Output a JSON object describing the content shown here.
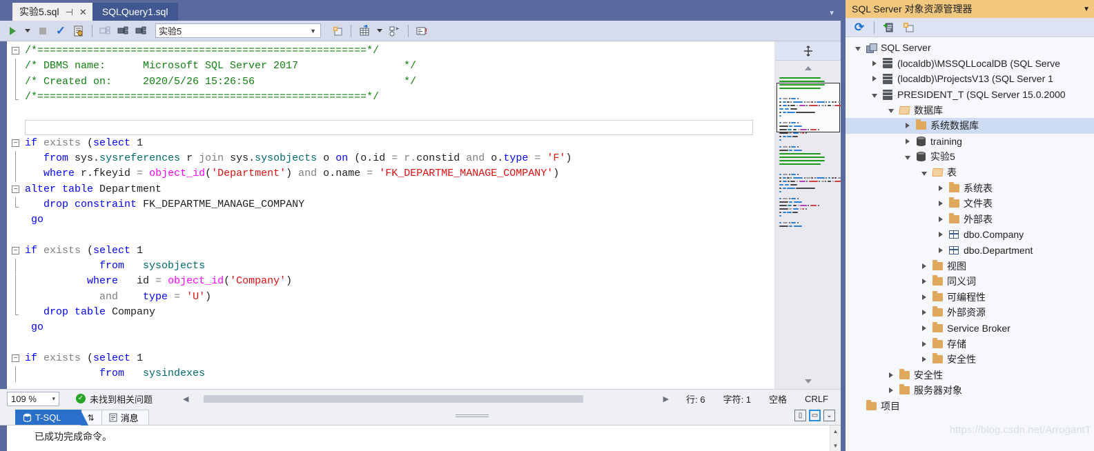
{
  "window": {
    "tab_overflow_icon": "chevron-down-icon"
  },
  "editor_tabs": [
    {
      "label": "实验5.sql",
      "active": true,
      "pin_icon": "pin-icon",
      "close_icon": "close-icon"
    },
    {
      "label": "SQLQuery1.sql",
      "active": false
    }
  ],
  "toolbar": {
    "execute_icon": "play-icon",
    "execute_dropdown_icon": "caret-down-icon",
    "stop_icon": "stop-icon",
    "parse_icon": "check-icon",
    "debug_icon": "debug-script-icon",
    "disconnect_icon": "disconnect-icon",
    "connect_icon": "connect-icon",
    "change_connection_icon": "change-connection-icon",
    "database_combo_value": "实验5",
    "database_combo_caret": "caret-down-icon",
    "new_query_icon": "new-query-icon",
    "include_actual_plan_icon": "grid-plan-icon",
    "include_plan_caret": "caret-down-icon",
    "estimated_plan_icon": "estimated-plan-icon",
    "results_to_text_icon": "results-to-text-icon"
  },
  "code": {
    "lines": [
      {
        "fold": "minus",
        "guide": "none",
        "tokens": [
          {
            "t": "/*=====================================================*/",
            "c": "cm"
          }
        ]
      },
      {
        "guide": "bar",
        "tokens": [
          {
            "t": "/* DBMS name:      Microsoft SQL Server 2017                 */",
            "c": "cm"
          }
        ]
      },
      {
        "guide": "bar",
        "tokens": [
          {
            "t": "/* Created on:     2020/5/26 15:26:56                        */",
            "c": "cm"
          }
        ]
      },
      {
        "guide": "end",
        "tokens": [
          {
            "t": "/*=====================================================*/",
            "c": "cm"
          }
        ]
      },
      {
        "guide": "none",
        "tokens": []
      },
      {
        "guide": "none",
        "tokens": [],
        "cursor_box": true
      },
      {
        "fold": "minus",
        "tokens": [
          {
            "t": "if ",
            "c": "kw"
          },
          {
            "t": "exists ",
            "c": "gr"
          },
          {
            "t": "(",
            "c": "pl"
          },
          {
            "t": "select ",
            "c": "kw"
          },
          {
            "t": "1",
            "c": "pl"
          }
        ]
      },
      {
        "guide": "bar",
        "tokens": [
          {
            "t": "   ",
            "c": "pl"
          },
          {
            "t": "from ",
            "c": "kw"
          },
          {
            "t": "sys",
            "c": "pl"
          },
          {
            "t": ".",
            "c": "pl"
          },
          {
            "t": "sysreferences ",
            "c": "tealish"
          },
          {
            "t": "r ",
            "c": "pl"
          },
          {
            "t": "join ",
            "c": "gr"
          },
          {
            "t": "sys",
            "c": "pl"
          },
          {
            "t": ".",
            "c": "pl"
          },
          {
            "t": "sysobjects ",
            "c": "tealish"
          },
          {
            "t": "o ",
            "c": "pl"
          },
          {
            "t": "on ",
            "c": "kw"
          },
          {
            "t": "(o.",
            "c": "pl"
          },
          {
            "t": "id ",
            "c": "pl"
          },
          {
            "t": "= r.",
            "c": "gr"
          },
          {
            "t": "constid ",
            "c": "pl"
          },
          {
            "t": "and ",
            "c": "gr"
          },
          {
            "t": "o.",
            "c": "pl"
          },
          {
            "t": "type ",
            "c": "kw"
          },
          {
            "t": "= ",
            "c": "gr"
          },
          {
            "t": "'F'",
            "c": "str"
          },
          {
            "t": ")",
            "c": "pl"
          }
        ]
      },
      {
        "guide": "bar",
        "tokens": [
          {
            "t": "   ",
            "c": "pl"
          },
          {
            "t": "where ",
            "c": "kw"
          },
          {
            "t": "r.",
            "c": "pl"
          },
          {
            "t": "fkeyid ",
            "c": "pl"
          },
          {
            "t": "= ",
            "c": "gr"
          },
          {
            "t": "object_id",
            "c": "fn"
          },
          {
            "t": "(",
            "c": "pl"
          },
          {
            "t": "'Department'",
            "c": "str"
          },
          {
            "t": ") ",
            "c": "pl"
          },
          {
            "t": "and ",
            "c": "gr"
          },
          {
            "t": "o.",
            "c": "pl"
          },
          {
            "t": "name ",
            "c": "pl"
          },
          {
            "t": "= ",
            "c": "gr"
          },
          {
            "t": "'FK_DEPARTME_MANAGE_COMPANY'",
            "c": "str"
          },
          {
            "t": ")",
            "c": "pl"
          }
        ]
      },
      {
        "fold": "minus",
        "tokens": [
          {
            "t": "alter ",
            "c": "kw"
          },
          {
            "t": "table ",
            "c": "kw"
          },
          {
            "t": "Department",
            "c": "pl"
          }
        ]
      },
      {
        "guide": "end",
        "tokens": [
          {
            "t": "   ",
            "c": "pl"
          },
          {
            "t": "drop ",
            "c": "kw"
          },
          {
            "t": "constraint ",
            "c": "kw"
          },
          {
            "t": "FK_DEPARTME_MANAGE_COMPANY",
            "c": "pl"
          }
        ]
      },
      {
        "guide": "none",
        "tokens": [
          {
            "t": " go",
            "c": "kw"
          }
        ]
      },
      {
        "guide": "none",
        "tokens": []
      },
      {
        "fold": "minus",
        "tokens": [
          {
            "t": "if ",
            "c": "kw"
          },
          {
            "t": "exists ",
            "c": "gr"
          },
          {
            "t": "(",
            "c": "pl"
          },
          {
            "t": "select ",
            "c": "kw"
          },
          {
            "t": "1",
            "c": "pl"
          }
        ]
      },
      {
        "guide": "bar",
        "tokens": [
          {
            "t": "            ",
            "c": "pl"
          },
          {
            "t": "from ",
            "c": "kw"
          },
          {
            "t": "  sysobjects",
            "c": "tealish"
          }
        ]
      },
      {
        "guide": "bar",
        "tokens": [
          {
            "t": "          ",
            "c": "pl"
          },
          {
            "t": "where ",
            "c": "kw"
          },
          {
            "t": "  id ",
            "c": "pl"
          },
          {
            "t": "= ",
            "c": "gr"
          },
          {
            "t": "object_id",
            "c": "fn"
          },
          {
            "t": "(",
            "c": "pl"
          },
          {
            "t": "'Company'",
            "c": "str"
          },
          {
            "t": ")",
            "c": "pl"
          }
        ]
      },
      {
        "guide": "bar",
        "tokens": [
          {
            "t": "            ",
            "c": "pl"
          },
          {
            "t": "and ",
            "c": "gr"
          },
          {
            "t": "   type ",
            "c": "kw"
          },
          {
            "t": "= ",
            "c": "gr"
          },
          {
            "t": "'U'",
            "c": "str"
          },
          {
            "t": ")",
            "c": "pl"
          }
        ]
      },
      {
        "guide": "end",
        "tokens": [
          {
            "t": "   ",
            "c": "pl"
          },
          {
            "t": "drop ",
            "c": "kw"
          },
          {
            "t": "table ",
            "c": "kw"
          },
          {
            "t": "Company",
            "c": "pl"
          }
        ]
      },
      {
        "guide": "none",
        "tokens": [
          {
            "t": " go",
            "c": "kw"
          }
        ]
      },
      {
        "guide": "none",
        "tokens": []
      },
      {
        "fold": "minus",
        "tokens": [
          {
            "t": "if ",
            "c": "kw"
          },
          {
            "t": "exists ",
            "c": "gr"
          },
          {
            "t": "(",
            "c": "pl"
          },
          {
            "t": "select ",
            "c": "kw"
          },
          {
            "t": "1",
            "c": "pl"
          }
        ]
      },
      {
        "guide": "bar",
        "tokens": [
          {
            "t": "            ",
            "c": "pl"
          },
          {
            "t": "from ",
            "c": "kw"
          },
          {
            "t": "  sysindexes",
            "c": "tealish"
          }
        ]
      }
    ]
  },
  "minimap": {
    "splitter_icon": "split-editor-icon",
    "scroll_up_icon": "scroll-up-icon",
    "scroll_down_icon": "scroll-down-icon"
  },
  "status_bar": {
    "zoom": "109 %",
    "zoom_caret": "caret-down-icon",
    "problems_icon": "ok-check-icon",
    "problems_text": "未找到相关问题",
    "scroll_left_icon": "scroll-left-icon",
    "scroll_right_icon": "scroll-right-icon",
    "line": "行: 6",
    "column": "字符: 1",
    "spaces": "空格",
    "line_ending": "CRLF"
  },
  "results": {
    "tabs": [
      {
        "label": "T-SQL",
        "icon": "tsql-icon",
        "selected": true
      },
      {
        "label": "",
        "icon": "sort-updown-icon",
        "selected": false
      },
      {
        "label": "消息",
        "icon": "message-icon",
        "selected": false
      }
    ],
    "panel_buttons": [
      {
        "icon": "split-vertical-icon",
        "active": false
      },
      {
        "icon": "split-horizontal-icon",
        "active": true
      },
      {
        "icon": "maximize-panel-icon",
        "active": false
      }
    ],
    "message": "已成功完成命令。",
    "scroll_up_icon": "scroll-up-icon",
    "scroll_down_icon": "scroll-down-icon"
  },
  "object_explorer": {
    "title": "SQL Server 对象资源管理器",
    "header_caret_icon": "caret-down-icon",
    "toolbar": {
      "refresh_icon": "refresh-icon",
      "add_server_icon": "add-sql-server-icon",
      "new_query_icon": "new-query-window-icon"
    },
    "watermark": "https://blog.csdn.net/ArrogantT",
    "tree": [
      {
        "depth": 0,
        "twist": "open",
        "icon": "servers-icon",
        "label": "SQL Server"
      },
      {
        "depth": 1,
        "twist": "closed",
        "icon": "server-icon",
        "label": "(localdb)\\MSSQLLocalDB (SQL Serve"
      },
      {
        "depth": 1,
        "twist": "closed",
        "icon": "server-icon",
        "label": "(localdb)\\ProjectsV13 (SQL Server 1"
      },
      {
        "depth": 1,
        "twist": "open",
        "icon": "server-icon",
        "label": "PRESIDENT_T (SQL Server 15.0.2000"
      },
      {
        "depth": 2,
        "twist": "open",
        "icon": "folder-open-icon",
        "label": "数据库"
      },
      {
        "depth": 3,
        "twist": "closed",
        "icon": "folder-icon",
        "label": "系统数据库",
        "selected": true
      },
      {
        "depth": 3,
        "twist": "closed",
        "icon": "database-icon",
        "label": "training"
      },
      {
        "depth": 3,
        "twist": "open",
        "icon": "database-icon",
        "label": "实验5"
      },
      {
        "depth": 4,
        "twist": "open",
        "icon": "folder-open-icon",
        "label": "表"
      },
      {
        "depth": 5,
        "twist": "closed",
        "icon": "folder-icon",
        "label": "系统表"
      },
      {
        "depth": 5,
        "twist": "closed",
        "icon": "folder-icon",
        "label": "文件表"
      },
      {
        "depth": 5,
        "twist": "closed",
        "icon": "folder-icon",
        "label": "外部表"
      },
      {
        "depth": 5,
        "twist": "closed",
        "icon": "table-icon",
        "label": "dbo.Company"
      },
      {
        "depth": 5,
        "twist": "closed",
        "icon": "table-icon",
        "label": "dbo.Department"
      },
      {
        "depth": 4,
        "twist": "closed",
        "icon": "folder-icon",
        "label": "视图"
      },
      {
        "depth": 4,
        "twist": "closed",
        "icon": "folder-icon",
        "label": "同义词"
      },
      {
        "depth": 4,
        "twist": "closed",
        "icon": "folder-icon",
        "label": "可编程性"
      },
      {
        "depth": 4,
        "twist": "closed",
        "icon": "folder-icon",
        "label": "外部资源"
      },
      {
        "depth": 4,
        "twist": "closed",
        "icon": "folder-icon",
        "label": "Service Broker"
      },
      {
        "depth": 4,
        "twist": "closed",
        "icon": "folder-icon",
        "label": "存储"
      },
      {
        "depth": 4,
        "twist": "closed",
        "icon": "folder-icon",
        "label": "安全性"
      },
      {
        "depth": 2,
        "twist": "closed",
        "icon": "folder-icon",
        "label": "安全性"
      },
      {
        "depth": 2,
        "twist": "closed",
        "icon": "folder-icon",
        "label": "服务器对象"
      },
      {
        "depth": 0,
        "twist": "none",
        "icon": "folder-icon",
        "label": "项目"
      }
    ]
  }
}
